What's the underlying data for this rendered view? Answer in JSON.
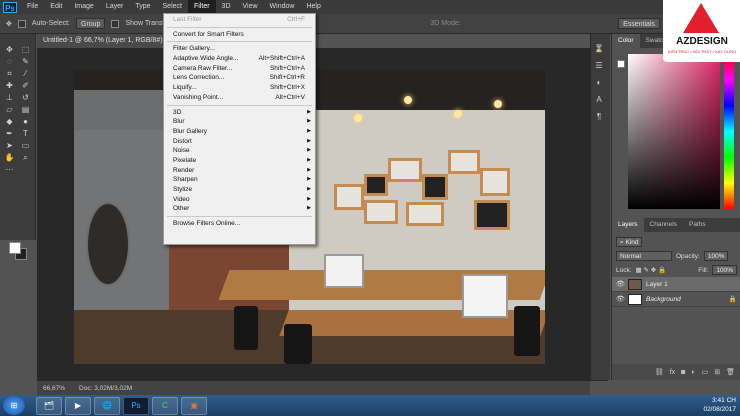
{
  "menubar": {
    "logo": "Ps",
    "items": [
      "File",
      "Edit",
      "Image",
      "Layer",
      "Type",
      "Select",
      "Filter",
      "3D",
      "View",
      "Window",
      "Help"
    ],
    "active_index": 6
  },
  "options": {
    "auto_select_label": "Auto-Select:",
    "group_value": "Group",
    "show_transform_label": "Show Transf",
    "mode_3d": "3D Mode:",
    "workspace": "Essentials"
  },
  "document": {
    "tab_title": "Untitled-1 @ 66,7% (Layer 1, RGB/8#) ×"
  },
  "filter_menu": {
    "items": [
      {
        "label": "Last Filter",
        "shortcut": "Ctrl+F",
        "disabled": true
      },
      {
        "sep": true
      },
      {
        "label": "Convert for Smart Filters"
      },
      {
        "sep": true
      },
      {
        "label": "Filter Gallery..."
      },
      {
        "label": "Adaptive Wide Angle...",
        "shortcut": "Alt+Shift+Ctrl+A"
      },
      {
        "label": "Camera Raw Filter...",
        "shortcut": "Shift+Ctrl+A"
      },
      {
        "label": "Lens Correction...",
        "shortcut": "Shift+Ctrl+R"
      },
      {
        "label": "Liquify...",
        "shortcut": "Shift+Ctrl+X"
      },
      {
        "label": "Vanishing Point...",
        "shortcut": "Alt+Ctrl+V"
      },
      {
        "sep": true
      },
      {
        "label": "3D",
        "submenu": true
      },
      {
        "label": "Blur",
        "submenu": true
      },
      {
        "label": "Blur Gallery",
        "submenu": true
      },
      {
        "label": "Distort",
        "submenu": true
      },
      {
        "label": "Noise",
        "submenu": true
      },
      {
        "label": "Pixelate",
        "submenu": true
      },
      {
        "label": "Render",
        "submenu": true
      },
      {
        "label": "Sharpen",
        "submenu": true
      },
      {
        "label": "Stylize",
        "submenu": true
      },
      {
        "label": "Video",
        "submenu": true
      },
      {
        "label": "Other",
        "submenu": true
      },
      {
        "sep": true
      },
      {
        "label": "Browse Filters Online..."
      }
    ]
  },
  "color_panel": {
    "tabs": [
      "Color",
      "Swatches"
    ],
    "active": 0
  },
  "layers_panel": {
    "tabs": [
      "Layers",
      "Channels",
      "Paths"
    ],
    "kind_label": "Kind",
    "blend_mode": "Normal",
    "opacity_label": "Opacity:",
    "opacity_value": "100%",
    "lock_label": "Lock:",
    "fill_label": "Fill:",
    "fill_value": "100%",
    "layers": [
      {
        "name": "Layer 1",
        "selected": true,
        "italic": false
      },
      {
        "name": "Background",
        "selected": false,
        "italic": true
      }
    ]
  },
  "logo": {
    "text": "AZDESIGN",
    "subtitle": "KIẾN TRÚC • NỘI THẤT • XÂY DỰNG"
  },
  "status": {
    "zoom": "66,67%",
    "doc": "Doc: 3,02M/3,02M"
  },
  "taskbar": {
    "start_label": "⊞",
    "apps": [
      "🗂",
      "▶",
      "🌐",
      "Ps",
      "C",
      "▣"
    ],
    "time": "3:41 CH",
    "date": "02/08/2017"
  }
}
